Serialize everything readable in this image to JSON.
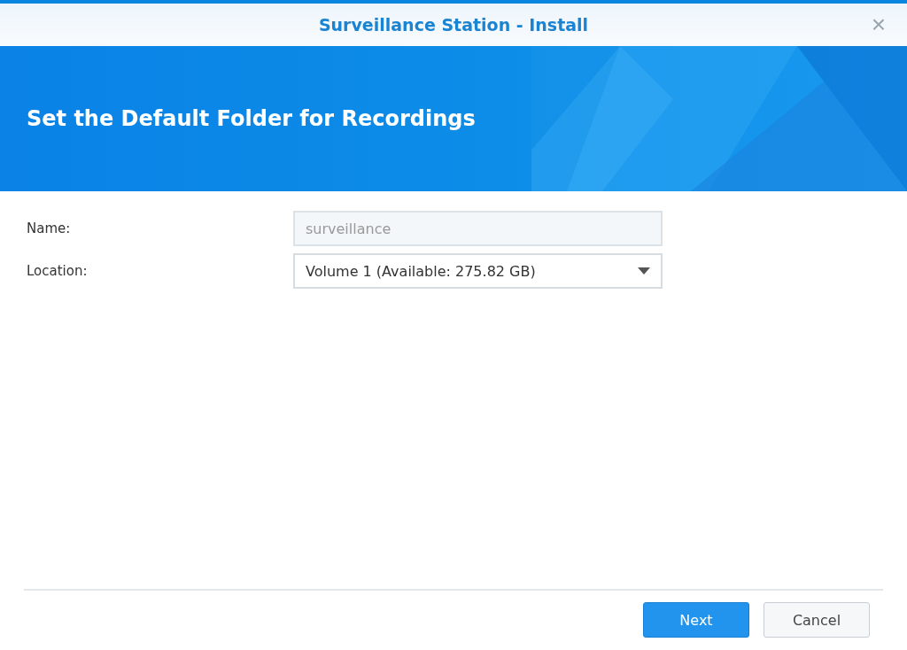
{
  "window": {
    "title": "Surveillance Station - Install",
    "close": "×"
  },
  "banner": {
    "heading": "Set the Default Folder for Recordings"
  },
  "fields": [
    {
      "label": "Name:",
      "kind": "text",
      "value": "surveillance",
      "disabled": true
    },
    {
      "label": "Location:",
      "kind": "dropdown",
      "value": "Volume 1 (Available: 275.82 GB)",
      "disabled": false
    }
  ],
  "buttons": [
    {
      "label": "Next",
      "kind": "primary"
    },
    {
      "label": "Cancel",
      "kind": "secondary"
    }
  ]
}
